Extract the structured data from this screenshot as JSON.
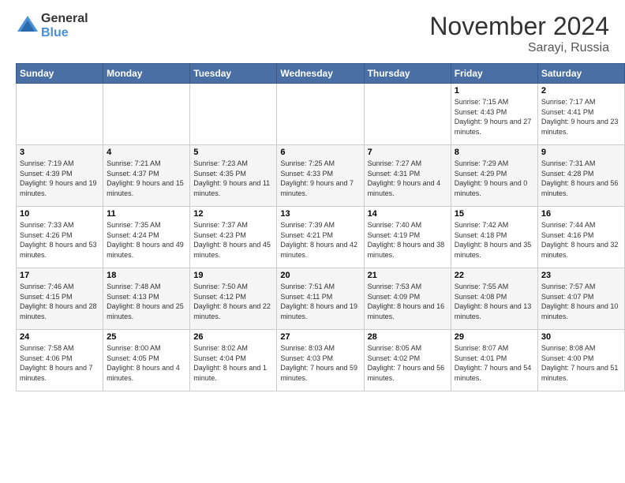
{
  "header": {
    "logo_general": "General",
    "logo_blue": "Blue",
    "month_title": "November 2024",
    "location": "Sarayi, Russia"
  },
  "weekdays": [
    "Sunday",
    "Monday",
    "Tuesday",
    "Wednesday",
    "Thursday",
    "Friday",
    "Saturday"
  ],
  "weeks": [
    [
      {
        "day": "",
        "sunrise": "",
        "sunset": "",
        "daylight": ""
      },
      {
        "day": "",
        "sunrise": "",
        "sunset": "",
        "daylight": ""
      },
      {
        "day": "",
        "sunrise": "",
        "sunset": "",
        "daylight": ""
      },
      {
        "day": "",
        "sunrise": "",
        "sunset": "",
        "daylight": ""
      },
      {
        "day": "",
        "sunrise": "",
        "sunset": "",
        "daylight": ""
      },
      {
        "day": "1",
        "sunrise": "Sunrise: 7:15 AM",
        "sunset": "Sunset: 4:43 PM",
        "daylight": "Daylight: 9 hours and 27 minutes."
      },
      {
        "day": "2",
        "sunrise": "Sunrise: 7:17 AM",
        "sunset": "Sunset: 4:41 PM",
        "daylight": "Daylight: 9 hours and 23 minutes."
      }
    ],
    [
      {
        "day": "3",
        "sunrise": "Sunrise: 7:19 AM",
        "sunset": "Sunset: 4:39 PM",
        "daylight": "Daylight: 9 hours and 19 minutes."
      },
      {
        "day": "4",
        "sunrise": "Sunrise: 7:21 AM",
        "sunset": "Sunset: 4:37 PM",
        "daylight": "Daylight: 9 hours and 15 minutes."
      },
      {
        "day": "5",
        "sunrise": "Sunrise: 7:23 AM",
        "sunset": "Sunset: 4:35 PM",
        "daylight": "Daylight: 9 hours and 11 minutes."
      },
      {
        "day": "6",
        "sunrise": "Sunrise: 7:25 AM",
        "sunset": "Sunset: 4:33 PM",
        "daylight": "Daylight: 9 hours and 7 minutes."
      },
      {
        "day": "7",
        "sunrise": "Sunrise: 7:27 AM",
        "sunset": "Sunset: 4:31 PM",
        "daylight": "Daylight: 9 hours and 4 minutes."
      },
      {
        "day": "8",
        "sunrise": "Sunrise: 7:29 AM",
        "sunset": "Sunset: 4:29 PM",
        "daylight": "Daylight: 9 hours and 0 minutes."
      },
      {
        "day": "9",
        "sunrise": "Sunrise: 7:31 AM",
        "sunset": "Sunset: 4:28 PM",
        "daylight": "Daylight: 8 hours and 56 minutes."
      }
    ],
    [
      {
        "day": "10",
        "sunrise": "Sunrise: 7:33 AM",
        "sunset": "Sunset: 4:26 PM",
        "daylight": "Daylight: 8 hours and 53 minutes."
      },
      {
        "day": "11",
        "sunrise": "Sunrise: 7:35 AM",
        "sunset": "Sunset: 4:24 PM",
        "daylight": "Daylight: 8 hours and 49 minutes."
      },
      {
        "day": "12",
        "sunrise": "Sunrise: 7:37 AM",
        "sunset": "Sunset: 4:23 PM",
        "daylight": "Daylight: 8 hours and 45 minutes."
      },
      {
        "day": "13",
        "sunrise": "Sunrise: 7:39 AM",
        "sunset": "Sunset: 4:21 PM",
        "daylight": "Daylight: 8 hours and 42 minutes."
      },
      {
        "day": "14",
        "sunrise": "Sunrise: 7:40 AM",
        "sunset": "Sunset: 4:19 PM",
        "daylight": "Daylight: 8 hours and 38 minutes."
      },
      {
        "day": "15",
        "sunrise": "Sunrise: 7:42 AM",
        "sunset": "Sunset: 4:18 PM",
        "daylight": "Daylight: 8 hours and 35 minutes."
      },
      {
        "day": "16",
        "sunrise": "Sunrise: 7:44 AM",
        "sunset": "Sunset: 4:16 PM",
        "daylight": "Daylight: 8 hours and 32 minutes."
      }
    ],
    [
      {
        "day": "17",
        "sunrise": "Sunrise: 7:46 AM",
        "sunset": "Sunset: 4:15 PM",
        "daylight": "Daylight: 8 hours and 28 minutes."
      },
      {
        "day": "18",
        "sunrise": "Sunrise: 7:48 AM",
        "sunset": "Sunset: 4:13 PM",
        "daylight": "Daylight: 8 hours and 25 minutes."
      },
      {
        "day": "19",
        "sunrise": "Sunrise: 7:50 AM",
        "sunset": "Sunset: 4:12 PM",
        "daylight": "Daylight: 8 hours and 22 minutes."
      },
      {
        "day": "20",
        "sunrise": "Sunrise: 7:51 AM",
        "sunset": "Sunset: 4:11 PM",
        "daylight": "Daylight: 8 hours and 19 minutes."
      },
      {
        "day": "21",
        "sunrise": "Sunrise: 7:53 AM",
        "sunset": "Sunset: 4:09 PM",
        "daylight": "Daylight: 8 hours and 16 minutes."
      },
      {
        "day": "22",
        "sunrise": "Sunrise: 7:55 AM",
        "sunset": "Sunset: 4:08 PM",
        "daylight": "Daylight: 8 hours and 13 minutes."
      },
      {
        "day": "23",
        "sunrise": "Sunrise: 7:57 AM",
        "sunset": "Sunset: 4:07 PM",
        "daylight": "Daylight: 8 hours and 10 minutes."
      }
    ],
    [
      {
        "day": "24",
        "sunrise": "Sunrise: 7:58 AM",
        "sunset": "Sunset: 4:06 PM",
        "daylight": "Daylight: 8 hours and 7 minutes."
      },
      {
        "day": "25",
        "sunrise": "Sunrise: 8:00 AM",
        "sunset": "Sunset: 4:05 PM",
        "daylight": "Daylight: 8 hours and 4 minutes."
      },
      {
        "day": "26",
        "sunrise": "Sunrise: 8:02 AM",
        "sunset": "Sunset: 4:04 PM",
        "daylight": "Daylight: 8 hours and 1 minute."
      },
      {
        "day": "27",
        "sunrise": "Sunrise: 8:03 AM",
        "sunset": "Sunset: 4:03 PM",
        "daylight": "Daylight: 7 hours and 59 minutes."
      },
      {
        "day": "28",
        "sunrise": "Sunrise: 8:05 AM",
        "sunset": "Sunset: 4:02 PM",
        "daylight": "Daylight: 7 hours and 56 minutes."
      },
      {
        "day": "29",
        "sunrise": "Sunrise: 8:07 AM",
        "sunset": "Sunset: 4:01 PM",
        "daylight": "Daylight: 7 hours and 54 minutes."
      },
      {
        "day": "30",
        "sunrise": "Sunrise: 8:08 AM",
        "sunset": "Sunset: 4:00 PM",
        "daylight": "Daylight: 7 hours and 51 minutes."
      }
    ]
  ]
}
